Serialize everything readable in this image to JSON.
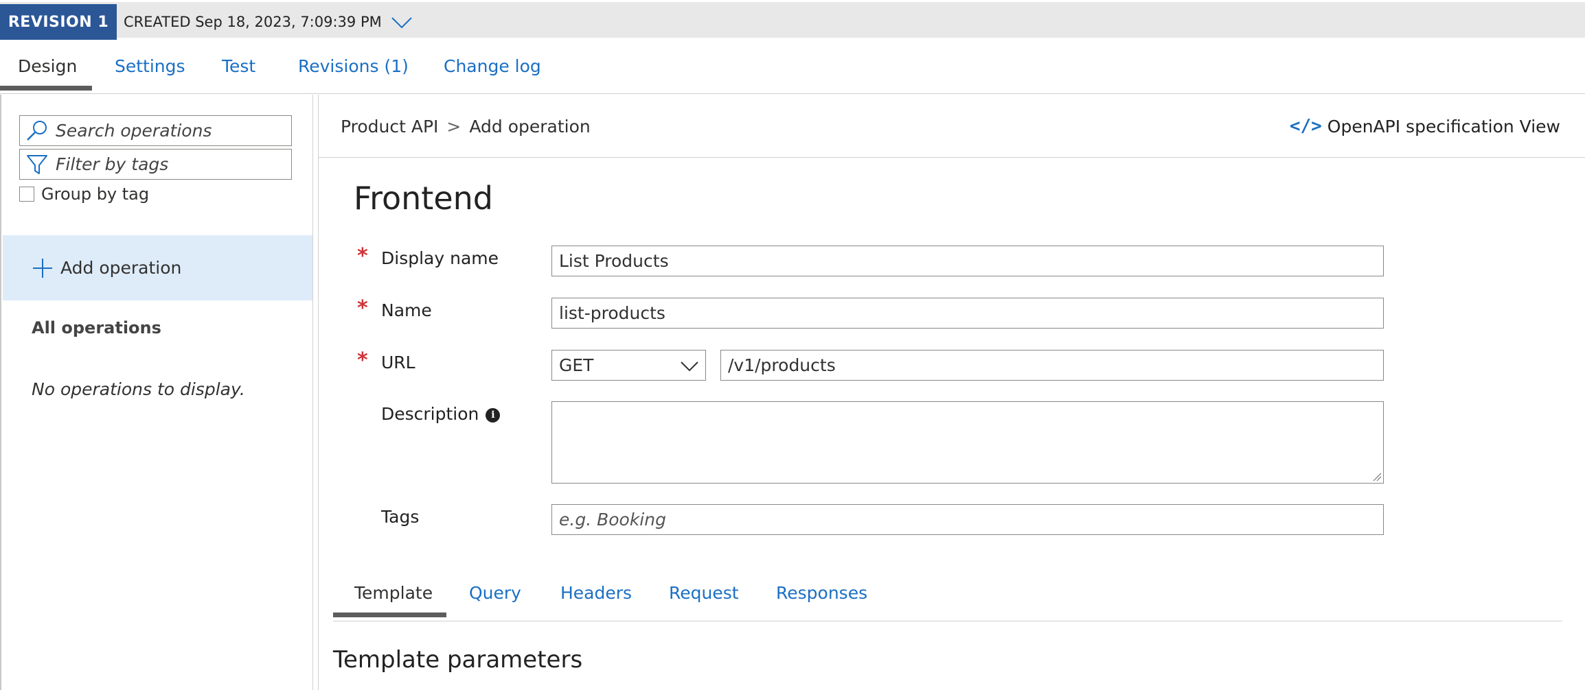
{
  "revision": {
    "badge": "REVISION 1",
    "created": "CREATED Sep 18, 2023, 7:09:39 PM"
  },
  "top_tabs": [
    {
      "label": "Design",
      "active": true
    },
    {
      "label": "Settings",
      "active": false
    },
    {
      "label": "Test",
      "active": false
    },
    {
      "label": "Revisions (1)",
      "active": false
    },
    {
      "label": "Change log",
      "active": false
    }
  ],
  "sidebar": {
    "search_placeholder": "Search operations",
    "filter_placeholder": "Filter by tags",
    "group_by_tag_label": "Group by tag",
    "group_by_tag_checked": false,
    "add_operation_label": "Add operation",
    "all_operations_label": "All operations",
    "empty_message": "No operations to display."
  },
  "breadcrumb": {
    "items": [
      "Product API",
      "Add operation"
    ],
    "separator": ">"
  },
  "openapi_link": {
    "icon": "code-icon",
    "label": "OpenAPI specification View"
  },
  "form": {
    "heading": "Frontend",
    "display_name": {
      "label": "Display name",
      "required": true,
      "value": "List Products"
    },
    "name": {
      "label": "Name",
      "required": true,
      "value": "list-products"
    },
    "url": {
      "label": "URL",
      "required": true,
      "method": "GET",
      "path": "/v1/products"
    },
    "description": {
      "label": "Description",
      "value": ""
    },
    "tags": {
      "label": "Tags",
      "placeholder": "e.g. Booking"
    }
  },
  "sub_tabs": [
    {
      "label": "Template",
      "active": true
    },
    {
      "label": "Query",
      "active": false
    },
    {
      "label": "Headers",
      "active": false
    },
    {
      "label": "Request",
      "active": false
    },
    {
      "label": "Responses",
      "active": false
    }
  ],
  "section_title": "Template parameters",
  "colors": {
    "accent": "#1a6fc4",
    "revision_badge": "#2b5797",
    "required": "#d13438",
    "selected_bg": "#deecf9"
  }
}
